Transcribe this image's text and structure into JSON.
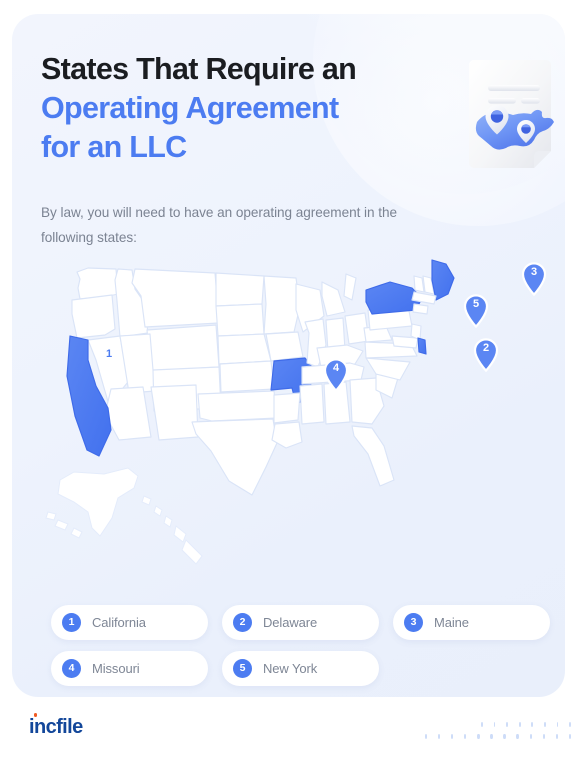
{
  "header": {
    "title_line1": "States That Require an",
    "title_line2": "Operating Agreement",
    "title_line3": "for an LLC",
    "subtitle": "By law, you will need to have an operating agreement in the following states:"
  },
  "illustration": {
    "name": "document-with-us-map-pins-illustration"
  },
  "map": {
    "name": "united-states-map",
    "highlighted_states": [
      "California",
      "Delaware",
      "Maine",
      "Missouri",
      "New York"
    ],
    "pins": [
      {
        "number": "1",
        "state": "California",
        "style": "outline"
      },
      {
        "number": "2",
        "state": "Delaware",
        "style": "filled"
      },
      {
        "number": "3",
        "state": "Maine",
        "style": "filled"
      },
      {
        "number": "4",
        "state": "Missouri",
        "style": "filled"
      },
      {
        "number": "5",
        "state": "New York",
        "style": "filled"
      }
    ]
  },
  "legend": {
    "items": [
      {
        "number": "1",
        "label": "California"
      },
      {
        "number": "2",
        "label": "Delaware"
      },
      {
        "number": "3",
        "label": "Maine"
      },
      {
        "number": "4",
        "label": "Missouri"
      },
      {
        "number": "5",
        "label": "New York"
      }
    ]
  },
  "footer": {
    "logo_text": "incfile"
  },
  "colors": {
    "accent_blue": "#4C7CF1",
    "heading_dark": "#1B1D21",
    "body_gray": "#7B8392",
    "card_bg": "#EEF3FD",
    "logo_blue": "#13479A",
    "logo_dot_orange": "#F05A22",
    "dot_pattern": "#CDDCF8",
    "state_fill": "#FFFFFF",
    "state_stroke": "#D9E4F7"
  }
}
